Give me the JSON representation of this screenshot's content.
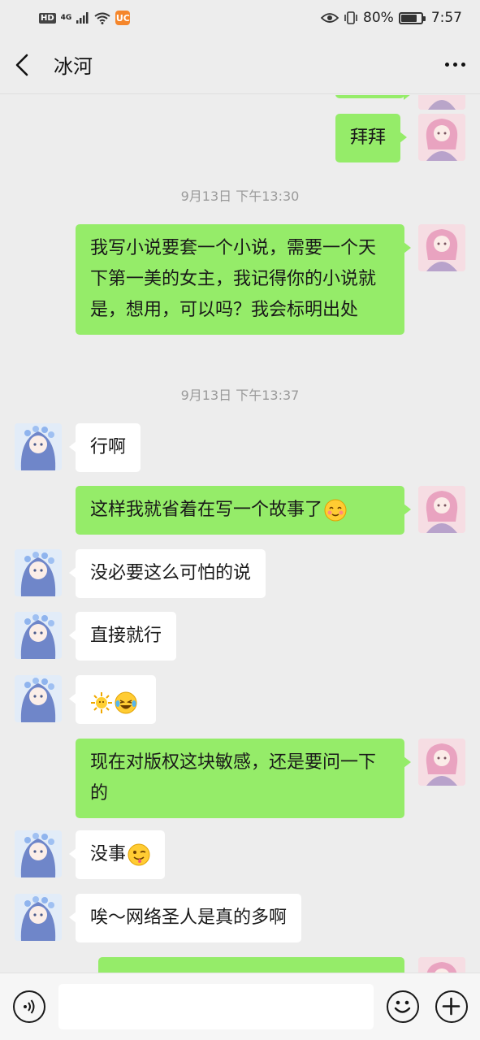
{
  "status_bar": {
    "hd": "HD",
    "network": "4G",
    "battery_percent": "80%",
    "battery_level": 0.8,
    "time": "7:57"
  },
  "header": {
    "title": "冰河"
  },
  "messages": {
    "m1": "拜拜",
    "ts1": "9月13日 下午13:30",
    "m2": "我写小说要套一个小说，需要一个天下第一美的女主，我记得你的小说就是，想用，可以吗？我会标明出处",
    "ts2": "9月13日 下午13:37",
    "m3": "行啊",
    "m4": "这样我就省着在写一个故事了",
    "m5": "没必要这么可怕的说",
    "m6": "直接就行",
    "m8": "现在对版权这块敏感，还是要问一下的",
    "m9": "没事",
    "m10": "唉～网络圣人是真的多啊"
  },
  "input": {
    "placeholder": ""
  },
  "colors": {
    "self_bubble": "#95ec69",
    "other_bubble": "#ffffff",
    "background": "#ededed"
  }
}
